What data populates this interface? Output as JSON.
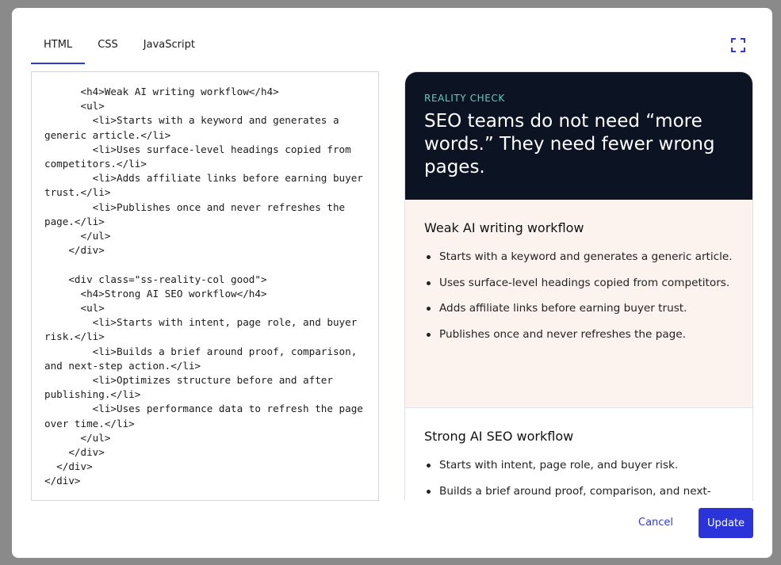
{
  "tabs": [
    {
      "label": "HTML",
      "active": true
    },
    {
      "label": "CSS",
      "active": false
    },
    {
      "label": "JavaScript",
      "active": false
    }
  ],
  "expand_icon": "expand-icon",
  "code_lines": [
    "      <h4>Weak AI writing workflow</h4>",
    "      <ul>",
    "        <li>Starts with a keyword and generates a generic article.</li>",
    "        <li>Uses surface-level headings copied from competitors.</li>",
    "        <li>Adds affiliate links before earning buyer trust.</li>",
    "        <li>Publishes once and never refreshes the page.</li>",
    "      </ul>",
    "    </div>",
    "",
    "    <div class=\"ss-reality-col good\">",
    "      <h4>Strong AI SEO workflow</h4>",
    "      <ul>",
    "        <li>Starts with intent, page role, and buyer risk.</li>",
    "        <li>Builds a brief around proof, comparison, and next-step action.</li>",
    "        <li>Optimizes structure before and after publishing.</li>",
    "        <li>Uses performance data to refresh the page over time.</li>",
    "      </ul>",
    "    </div>",
    "  </div>",
    "</div>"
  ],
  "preview": {
    "eyebrow": "REALITY CHECK",
    "headline": "SEO teams do not need “more words.” They need fewer wrong pages.",
    "weak": {
      "title": "Weak AI writing workflow",
      "items": [
        "Starts with a keyword and generates a generic article.",
        "Uses surface-level headings copied from competitors.",
        "Adds affiliate links before earning buyer trust.",
        "Publishes once and never refreshes the page."
      ]
    },
    "strong": {
      "title": "Strong AI SEO workflow",
      "items": [
        "Starts with intent, page role, and buyer risk.",
        "Builds a brief around proof, comparison, and next-step action."
      ]
    }
  },
  "buttons": {
    "cancel": "Cancel",
    "update": "Update"
  },
  "colors": {
    "accent": "#2a34d9",
    "hero_bg": "#0c1424",
    "eyebrow": "#5ad1b8",
    "weak_bg": "#fdf3ee"
  }
}
